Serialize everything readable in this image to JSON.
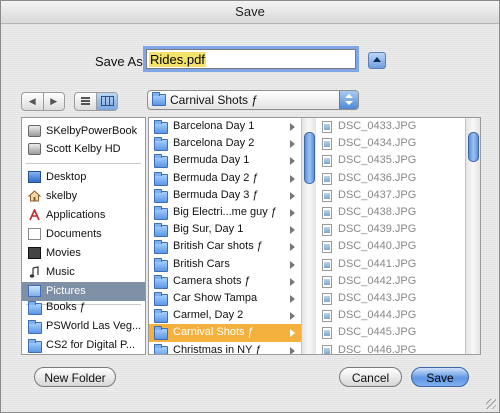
{
  "window": {
    "title": "Save"
  },
  "save_as": {
    "label": "Save As:",
    "filename": "Rides.pdf"
  },
  "location": {
    "selected": "Carnival Shots ƒ"
  },
  "sidebar": {
    "devices": [
      {
        "label": "SKelbyPowerBook",
        "icon": "laptop-drive-icon"
      },
      {
        "label": "Scott Kelby HD",
        "icon": "hard-drive-icon"
      }
    ],
    "places": [
      {
        "label": "Desktop",
        "icon": "desktop-icon"
      },
      {
        "label": "skelby",
        "icon": "home-icon"
      },
      {
        "label": "Applications",
        "icon": "applications-icon"
      },
      {
        "label": "Documents",
        "icon": "documents-icon"
      },
      {
        "label": "Movies",
        "icon": "movies-icon"
      },
      {
        "label": "Music",
        "icon": "music-icon"
      },
      {
        "label": "Pictures",
        "icon": "pictures-icon",
        "selected": true
      }
    ],
    "folders": [
      {
        "label": "Books ƒ",
        "icon": "folder-icon"
      },
      {
        "label": "PSWorld Las Veg...",
        "icon": "folder-icon"
      },
      {
        "label": "CS2 for Digital P...",
        "icon": "folder-icon"
      }
    ]
  },
  "browser": {
    "column1": [
      "Barcelona Day 1",
      "Barcelona Day 2",
      "Bermuda Day 1",
      "Bermuda Day 2 ƒ",
      "Bermuda Day 3 ƒ",
      "Big Electri...me guy ƒ",
      "Big Sur, Day 1",
      "British Car shots ƒ",
      "British Cars",
      "Camera shots ƒ",
      "Car Show Tampa",
      "Carmel, Day 2",
      "Carnival Shots ƒ",
      "Christmas in NY ƒ"
    ],
    "column1_selected": "Carnival Shots ƒ",
    "column2": [
      "DSC_0433.JPG",
      "DSC_0434.JPG",
      "DSC_0435.JPG",
      "DSC_0436.JPG",
      "DSC_0437.JPG",
      "DSC_0438.JPG",
      "DSC_0439.JPG",
      "DSC_0440.JPG",
      "DSC_0441.JPG",
      "DSC_0442.JPG",
      "DSC_0443.JPG",
      "DSC_0444.JPG",
      "DSC_0445.JPG",
      "DSC_0446.JPG"
    ]
  },
  "buttons": {
    "new_folder": "New Folder",
    "cancel": "Cancel",
    "save": "Save"
  },
  "colors": {
    "selection_orange": "#f5b13d",
    "sidebar_selection": "#7f8fa6",
    "accent_blue": "#5e95e3"
  }
}
